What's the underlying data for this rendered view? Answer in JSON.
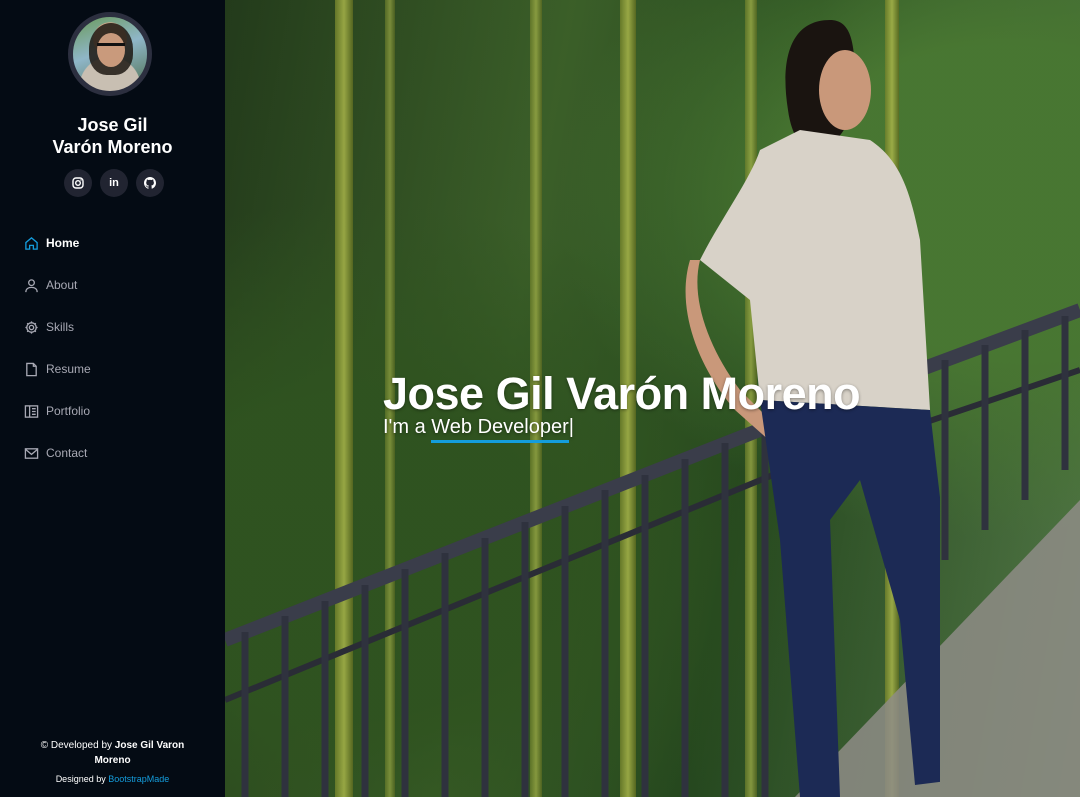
{
  "profile": {
    "name_line1": "Jose Gil",
    "name_line2": "Varón Moreno"
  },
  "social": [
    {
      "icon": "instagram-icon",
      "glyph": "◎"
    },
    {
      "icon": "linkedin-icon",
      "glyph": "in"
    },
    {
      "icon": "github-icon",
      "glyph": "⌥"
    }
  ],
  "nav": {
    "items": [
      {
        "label": "Home",
        "icon": "home-icon",
        "active": true
      },
      {
        "label": "About",
        "icon": "person-icon",
        "active": false
      },
      {
        "label": "Skills",
        "icon": "gear-icon",
        "active": false
      },
      {
        "label": "Resume",
        "icon": "file-icon",
        "active": false
      },
      {
        "label": "Portfolio",
        "icon": "book-icon",
        "active": false
      },
      {
        "label": "Contact",
        "icon": "envelope-icon",
        "active": false
      }
    ]
  },
  "footer": {
    "copyright_prefix": "© Developed by",
    "copyright_name": "Jose Gil Varon Moreno",
    "credits_prefix": "Designed by",
    "credits_link": "BootstrapMade"
  },
  "hero": {
    "title": "Jose Gil Varón Moreno",
    "subtitle_prefix": "I'm a",
    "typed_text": "Web Developer",
    "cursor": "|"
  },
  "colors": {
    "accent": "#149ddd",
    "sidebar_bg": "#040b14",
    "nav_text": "#a8a9b4"
  }
}
